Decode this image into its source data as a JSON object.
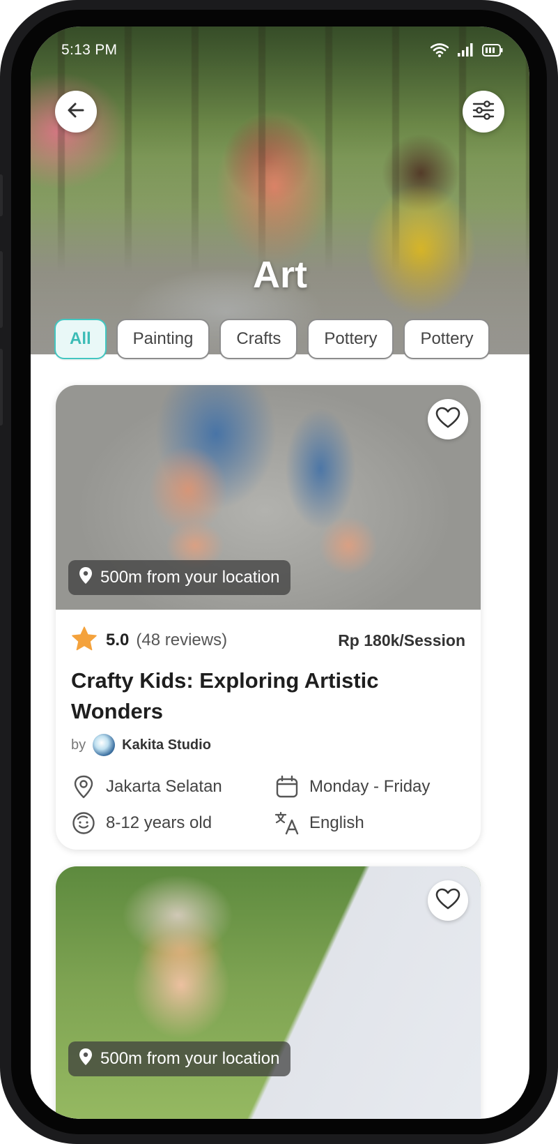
{
  "status_bar": {
    "time": "5:13 PM",
    "icons": [
      "wifi-icon",
      "signal-icon",
      "battery-icon"
    ]
  },
  "header": {
    "title": "Art",
    "back_icon": "arrow-left-icon",
    "filter_icon": "sliders-icon"
  },
  "categories": {
    "active": "All",
    "items": [
      "All",
      "Painting",
      "Crafts",
      "Pottery",
      "Pottery"
    ]
  },
  "colors": {
    "accent": "#42c6c0",
    "star": "#f4a23c"
  },
  "cards": [
    {
      "distance": "500m from your location",
      "rating": "5.0",
      "reviews": "(48 reviews)",
      "price": "Rp 180k/Session",
      "title": "Crafty Kids: Exploring Artistic Wonders",
      "by_label": "by",
      "studio": "Kakita Studio",
      "location": "Jakarta Selatan",
      "schedule": "Monday - Friday",
      "age": "8-12 years old",
      "language": "English"
    },
    {
      "distance": "500m from your location"
    }
  ]
}
